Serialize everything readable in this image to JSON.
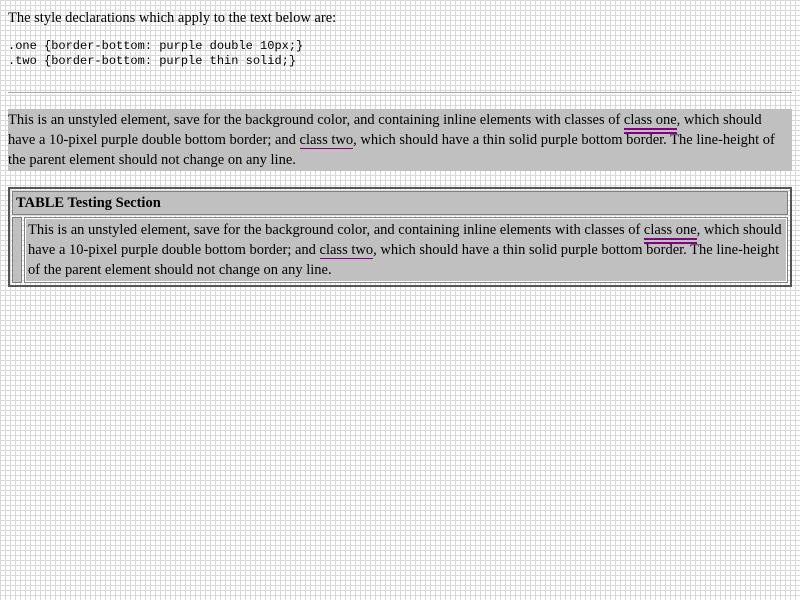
{
  "intro": "The style declarations which apply to the text below are:",
  "css_rules": [
    ".one {border-bottom: purple double 10px;}",
    ".two {border-bottom: purple thin solid;}"
  ],
  "paragraph": {
    "part1": "This is an unstyled element, save for the background color, and containing inline elements with classes of ",
    "class_one": "class one",
    "part2": ", which should have a 10-pixel purple double bottom border; and ",
    "class_two": "class two",
    "part3": ", which should have a thin solid purple bottom border. The line-height of the parent element should not change on any line."
  },
  "table": {
    "heading": "TABLE Testing Section"
  },
  "colors": {
    "test_background": "#c0c0c0",
    "border_accent": "purple"
  }
}
